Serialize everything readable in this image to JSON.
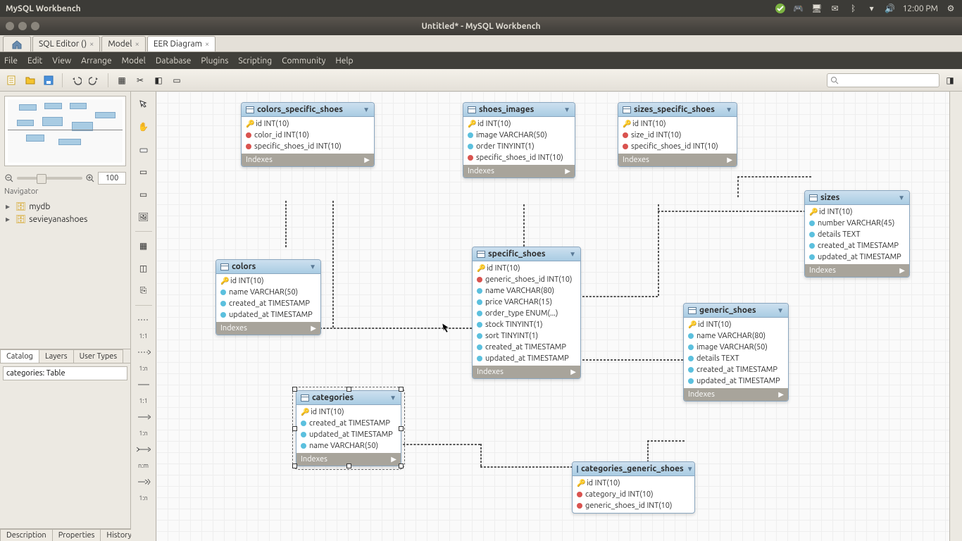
{
  "ubuntu": {
    "app_title": "MySQL Workbench",
    "time": "12:00 PM"
  },
  "window": {
    "title": "Untitled* - MySQL Workbench"
  },
  "tabs": {
    "sql_editor": "SQL Editor ()",
    "model": "Model",
    "eer": "EER Diagram"
  },
  "menu": {
    "file": "File",
    "edit": "Edit",
    "view": "View",
    "arrange": "Arrange",
    "model": "Model",
    "database": "Database",
    "plugins": "Plugins",
    "scripting": "Scripting",
    "community": "Community",
    "help": "Help"
  },
  "nav": {
    "label": "Navigator",
    "zoom": "100",
    "tree": {
      "db1": "mydb",
      "db2": "sevieyanashoes"
    },
    "side_tabs": {
      "catalog": "Catalog",
      "layers": "Layers",
      "user_types": "User Types"
    },
    "prop_value": "categories: Table",
    "bottom_tabs": {
      "description": "Description",
      "properties": "Properties",
      "history": "History"
    }
  },
  "palette_labels": {
    "r11": "1:1",
    "r1n": "1:n",
    "r11b": "1:1",
    "r1nb": "1:n",
    "rnm": "n:m",
    "r1nc": "1:n"
  },
  "idx_label": "Indexes",
  "entities": {
    "colors_specific_shoes": {
      "name": "colors_specific_shoes",
      "cols": [
        {
          "k": "pk",
          "n": "id INT(10)"
        },
        {
          "k": "fk",
          "n": "color_id INT(10)"
        },
        {
          "k": "fk",
          "n": "specific_shoes_id INT(10)"
        }
      ]
    },
    "shoes_images": {
      "name": "shoes_images",
      "cols": [
        {
          "k": "pk",
          "n": "id INT(10)"
        },
        {
          "k": "c",
          "n": "image VARCHAR(50)"
        },
        {
          "k": "c",
          "n": "order TINYINT(1)"
        },
        {
          "k": "fk",
          "n": "specific_shoes_id INT(10)"
        }
      ]
    },
    "sizes_specific_shoes": {
      "name": "sizes_specific_shoes",
      "cols": [
        {
          "k": "pk",
          "n": "id INT(10)"
        },
        {
          "k": "fk",
          "n": "size_id INT(10)"
        },
        {
          "k": "fk",
          "n": "specific_shoes_id INT(10)"
        }
      ]
    },
    "sizes": {
      "name": "sizes",
      "cols": [
        {
          "k": "pk",
          "n": "id INT(10)"
        },
        {
          "k": "c",
          "n": "number VARCHAR(45)"
        },
        {
          "k": "c",
          "n": "details TEXT"
        },
        {
          "k": "c",
          "n": "created_at TIMESTAMP"
        },
        {
          "k": "c",
          "n": "updated_at TIMESTAMP"
        }
      ]
    },
    "colors": {
      "name": "colors",
      "cols": [
        {
          "k": "pk",
          "n": "id INT(10)"
        },
        {
          "k": "c",
          "n": "name VARCHAR(50)"
        },
        {
          "k": "c",
          "n": "created_at TIMESTAMP"
        },
        {
          "k": "c",
          "n": "updated_at TIMESTAMP"
        }
      ]
    },
    "specific_shoes": {
      "name": "specific_shoes",
      "cols": [
        {
          "k": "pk",
          "n": "id INT(10)"
        },
        {
          "k": "fk",
          "n": "generic_shoes_id INT(10)"
        },
        {
          "k": "c",
          "n": "name VARCHAR(80)"
        },
        {
          "k": "c",
          "n": "price VARCHAR(15)"
        },
        {
          "k": "c",
          "n": "order_type ENUM(...)"
        },
        {
          "k": "c",
          "n": "stock TINYINT(1)"
        },
        {
          "k": "c",
          "n": "sort TINYINT(1)"
        },
        {
          "k": "c",
          "n": "created_at TIMESTAMP"
        },
        {
          "k": "c",
          "n": "updated_at TIMESTAMP"
        }
      ]
    },
    "generic_shoes": {
      "name": "generic_shoes",
      "cols": [
        {
          "k": "pk",
          "n": "id INT(10)"
        },
        {
          "k": "c",
          "n": "name VARCHAR(80)"
        },
        {
          "k": "c",
          "n": "image VARCHAR(50)"
        },
        {
          "k": "c",
          "n": "details TEXT"
        },
        {
          "k": "c",
          "n": "created_at TIMESTAMP"
        },
        {
          "k": "c",
          "n": "updated_at TIMESTAMP"
        }
      ]
    },
    "categories": {
      "name": "categories",
      "cols": [
        {
          "k": "pk",
          "n": "id INT(10)"
        },
        {
          "k": "c",
          "n": "created_at TIMESTAMP"
        },
        {
          "k": "c",
          "n": "updated_at TIMESTAMP"
        },
        {
          "k": "c",
          "n": "name VARCHAR(50)"
        }
      ]
    },
    "categories_generic_shoes": {
      "name": "categories_generic_shoes",
      "cols": [
        {
          "k": "pk",
          "n": "id INT(10)"
        },
        {
          "k": "fk",
          "n": "category_id INT(10)"
        },
        {
          "k": "fk",
          "n": "generic_shoes_id INT(10)"
        }
      ]
    }
  }
}
